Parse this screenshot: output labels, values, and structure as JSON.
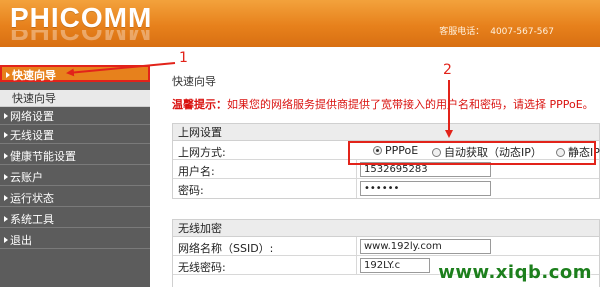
{
  "brand": {
    "logo_text": "PHICOMM"
  },
  "header": {
    "hotline_label": "客服电话：",
    "hotline_number": "4007-567-567"
  },
  "sidebar": {
    "items": [
      {
        "label": "快速向导"
      },
      {
        "label": "快速向导"
      },
      {
        "label": "网络设置"
      },
      {
        "label": "无线设置"
      },
      {
        "label": "健康节能设置"
      },
      {
        "label": "云账户"
      },
      {
        "label": "运行状态"
      },
      {
        "label": "系统工具"
      },
      {
        "label": "退出"
      }
    ]
  },
  "main": {
    "title": "快速向导",
    "tip_prefix": "温馨提示：",
    "tip_text": "如果您的网络服务提供商提供了宽带接入的用户名和密码，请选择 PPPoE。",
    "internet": {
      "heading": "上网设置",
      "mode_label": "上网方式:",
      "modes": [
        {
          "label": "PPPoE",
          "checked": true
        },
        {
          "label": "自动获取（动态IP）",
          "checked": false
        },
        {
          "label": "静态IP",
          "checked": false
        }
      ],
      "username_label": "用户名:",
      "username_value": "1532695283",
      "password_label": "密码:",
      "password_value": "••••••"
    },
    "wireless": {
      "heading": "无线加密",
      "ssid_label": "网络名称（SSID）:",
      "ssid_value": "www.192ly.com",
      "key_label": "无线密码:",
      "key_value": "192LY.c"
    }
  },
  "annotations": {
    "marker_1": "1",
    "marker_2": "2",
    "color": "#e2231a"
  },
  "watermark": "www.xiqb.com"
}
